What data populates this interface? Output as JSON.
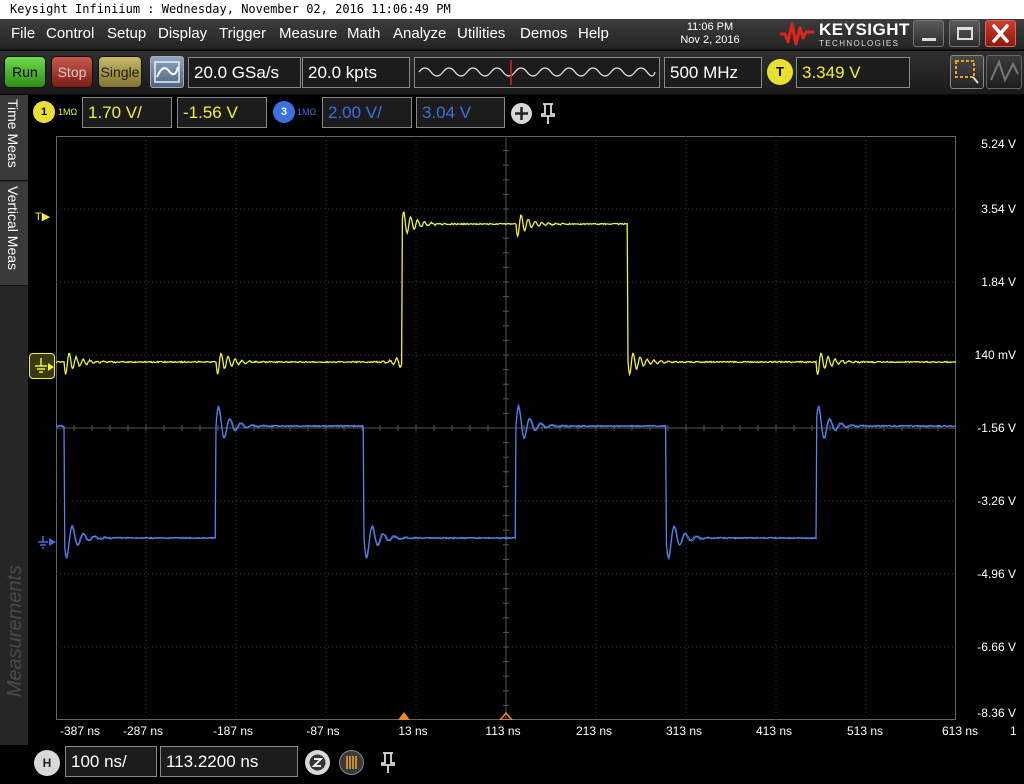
{
  "window": {
    "title": "Keysight Infiniium : Wednesday, November 02, 2016 11:06:49 PM"
  },
  "menu": {
    "items": [
      "File",
      "Control",
      "Setup",
      "Display",
      "Trigger",
      "Measure",
      "Math",
      "Analyze",
      "Utilities",
      "Demos",
      "Help"
    ]
  },
  "clock": {
    "time": "11:06 PM",
    "date": "Nov 2, 2016"
  },
  "brand": {
    "name": "KEYSIGHT",
    "sub": "TECHNOLOGIES",
    "accent": "#e0251b"
  },
  "toolbar": {
    "run": "Run",
    "stop": "Stop",
    "single": "Single",
    "sample_rate": "20.0 GSa/s",
    "memory_depth": "20.0 kpts",
    "bandwidth": "500 MHz",
    "trigger_badge": "T",
    "trigger_level": "3.349 V"
  },
  "channels": {
    "ch1": {
      "number": "1",
      "impedance": "1MΩ",
      "scale": "1.70 V/",
      "offset": "-1.56 V",
      "color": "#f2f230"
    },
    "ch3": {
      "number": "3",
      "impedance": "1MΩ",
      "scale": "2.00 V/",
      "offset": "3.04 V",
      "color": "#3d6fe0"
    }
  },
  "side_tabs": {
    "time_meas": "Time Meas",
    "vertical_meas": "Vertical Meas",
    "measurements": "Measurements"
  },
  "markers": {
    "trigger": "T"
  },
  "axes": {
    "y_labels": [
      "5.24 V",
      "3.54 V",
      "1.84 V",
      "140 mV",
      "-1.56 V",
      "-3.26 V",
      "-4.96 V",
      "-6.66 V",
      "-8.36 V"
    ],
    "x_labels": [
      "-387 ns",
      "-287 ns",
      "-187 ns",
      "-87 ns",
      "13 ns",
      "113 ns",
      "213 ns",
      "313 ns",
      "413 ns",
      "513 ns",
      "613 ns"
    ],
    "page_indicator": "1"
  },
  "horizontal": {
    "badge": "H",
    "scale": "100 ns/",
    "position": "113.2200 ns"
  }
}
